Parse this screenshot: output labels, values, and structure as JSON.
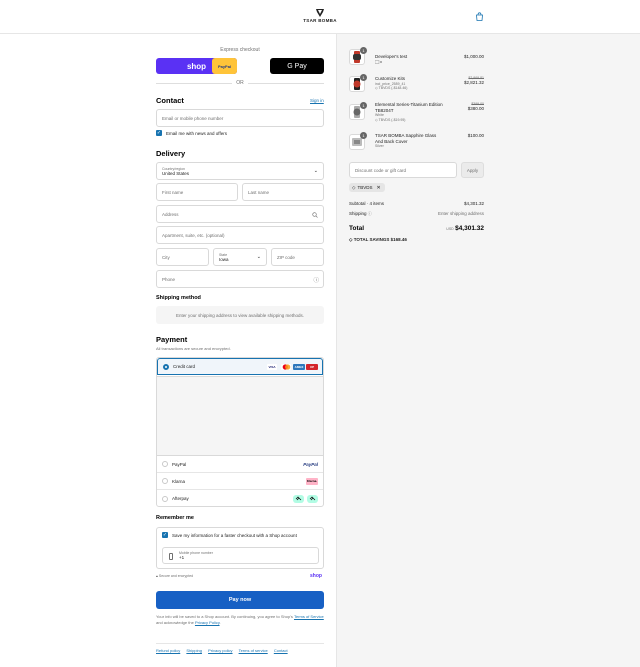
{
  "brand": {
    "name": "TSAR BOMBA"
  },
  "express": {
    "label": "Express checkout",
    "shop": "shop",
    "paypal": "PayPal",
    "gpay": "G Pay",
    "or": "OR"
  },
  "contact": {
    "heading": "Contact",
    "sign_in": "Sign in",
    "email_placeholder": "Email or mobile phone number",
    "news_label": "Email me with news and offers"
  },
  "delivery": {
    "heading": "Delivery",
    "country_label": "Country/region",
    "country_value": "United States",
    "first_name": "First name",
    "last_name": "Last name",
    "address": "Address",
    "apartment": "Apartment, suite, etc. (optional)",
    "city": "City",
    "state_label": "State",
    "state_value": "Iowa",
    "zip": "ZIP code",
    "phone": "Phone"
  },
  "shipping": {
    "heading": "Shipping method",
    "note": "Enter your shipping address to view available shipping methods."
  },
  "payment": {
    "heading": "Payment",
    "secure_note": "All transactions are secure and encrypted.",
    "credit_card": "Credit card",
    "paypal": "PayPal",
    "klarna": "Klarna",
    "afterpay": "Afterpay",
    "visa": "VISA",
    "amex": "AMEX",
    "union": "UP",
    "klarna_badge": "Klarna.",
    "paypal_logo": "PayPal"
  },
  "remember": {
    "heading": "Remember me",
    "save_label": "Save my information for a faster checkout with a Shop account",
    "mobile_label": "Mobile phone number",
    "mobile_value": "+1",
    "secure": "Secure and encrypted",
    "shop": "shop"
  },
  "pay_now": "Pay now",
  "legal": {
    "line1": "Your info will be saved to a Shop account. By continuing, you agree to Shop's",
    "terms": "Terms of Service",
    "and": "and acknowledge the",
    "privacy": "Privacy Policy",
    "end": "."
  },
  "footer": [
    "Refund policy",
    "Shipping",
    "Privacy policy",
    "Terms of service",
    "Contact"
  ],
  "summary": {
    "items": [
      {
        "qty": "1",
        "title": "Developer's test",
        "sub": "",
        "discount": "",
        "old_price": "",
        "price": "$1,000.00"
      },
      {
        "qty": "1",
        "title": "Customize Kits",
        "sub": "incl_price_2589_41",
        "discount": "TBVDS (-$148.46)",
        "old_price": "$2,969.81",
        "price": "$2,821.32"
      },
      {
        "qty": "1",
        "title": "Elemental Series-Titanium Edition TB8204T",
        "sub": "White",
        "discount": "TBVDS (-$19.95)",
        "old_price": "$399.00",
        "price": "$380.00"
      },
      {
        "qty": "1",
        "title": "TSAR BOMBA Sapphire Glass And Back Cover",
        "sub": "Silver",
        "discount": "",
        "old_price": "",
        "price": "$100.00"
      }
    ],
    "discount_placeholder": "Discount code or gift card",
    "apply": "Apply",
    "applied_code": "TBVDS",
    "subtotal_label": "Subtotal · 4 items",
    "subtotal_value": "$4,301.32",
    "shipping_label": "Shipping",
    "shipping_value": "Enter shipping address",
    "total_label": "Total",
    "currency": "USD",
    "total_value": "$4,301.32",
    "savings_label": "TOTAL SAVINGS",
    "savings_value": "$168.46"
  },
  "colors": {
    "accent": "#1773b0",
    "shop": "#5a31f4",
    "paypal": "#ffc439",
    "pay_now": "#1760c4"
  }
}
